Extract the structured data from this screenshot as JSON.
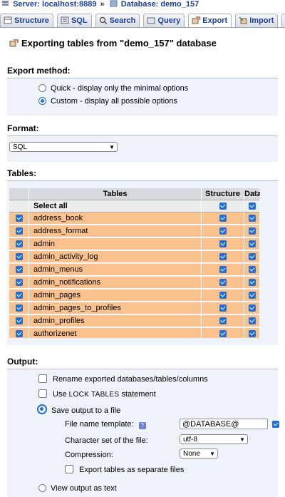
{
  "breadcrumb": {
    "server_label": "Server: localhost:8889",
    "separator": "»",
    "database_label": "Database: demo_157"
  },
  "tabs": [
    {
      "label": "Structure",
      "icon": "structure-icon",
      "active": false
    },
    {
      "label": "SQL",
      "icon": "sql-icon",
      "active": false
    },
    {
      "label": "Search",
      "icon": "search-icon",
      "active": false
    },
    {
      "label": "Query",
      "icon": "query-icon",
      "active": false
    },
    {
      "label": "Export",
      "icon": "export-icon",
      "active": true
    },
    {
      "label": "Import",
      "icon": "import-icon",
      "active": false
    },
    {
      "label": "O",
      "icon": "operations-icon",
      "active": false
    }
  ],
  "page_title": "Exporting tables from \"demo_157\" database",
  "export_method": {
    "heading": "Export method:",
    "options": [
      {
        "label": "Quick - display only the minimal options",
        "selected": false
      },
      {
        "label": "Custom - display all possible options",
        "selected": true
      }
    ]
  },
  "format": {
    "heading": "Format:",
    "selected": "SQL"
  },
  "tables": {
    "heading": "Tables:",
    "columns": [
      "Tables",
      "Structure",
      "Data"
    ],
    "select_all": "Select all",
    "rows": [
      "address_book",
      "address_format",
      "admin",
      "admin_activity_log",
      "admin_menus",
      "admin_notifications",
      "admin_pages",
      "admin_pages_to_profiles",
      "admin_profiles",
      "authorizenet"
    ]
  },
  "output": {
    "heading": "Output:",
    "rename_label": "Rename exported databases/tables/columns",
    "use_label_prefix": "Use",
    "use_label_code": "LOCK TABLES",
    "use_label_suffix": "statement",
    "save_label": "Save output to a file",
    "file_template_label": "File name template:",
    "file_template_value": "@DATABASE@",
    "charset_label": "Character set of the file:",
    "charset_value": "utf-8",
    "compression_label": "Compression:",
    "compression_value": "None",
    "separate_label": "Export tables as separate files",
    "view_label": "View output as text"
  },
  "colors": {
    "link": "#1a3f9c",
    "row_highlight": "#f9c18e",
    "checkbox": "#1f6fd6",
    "section_bg": "#eef3fa"
  }
}
